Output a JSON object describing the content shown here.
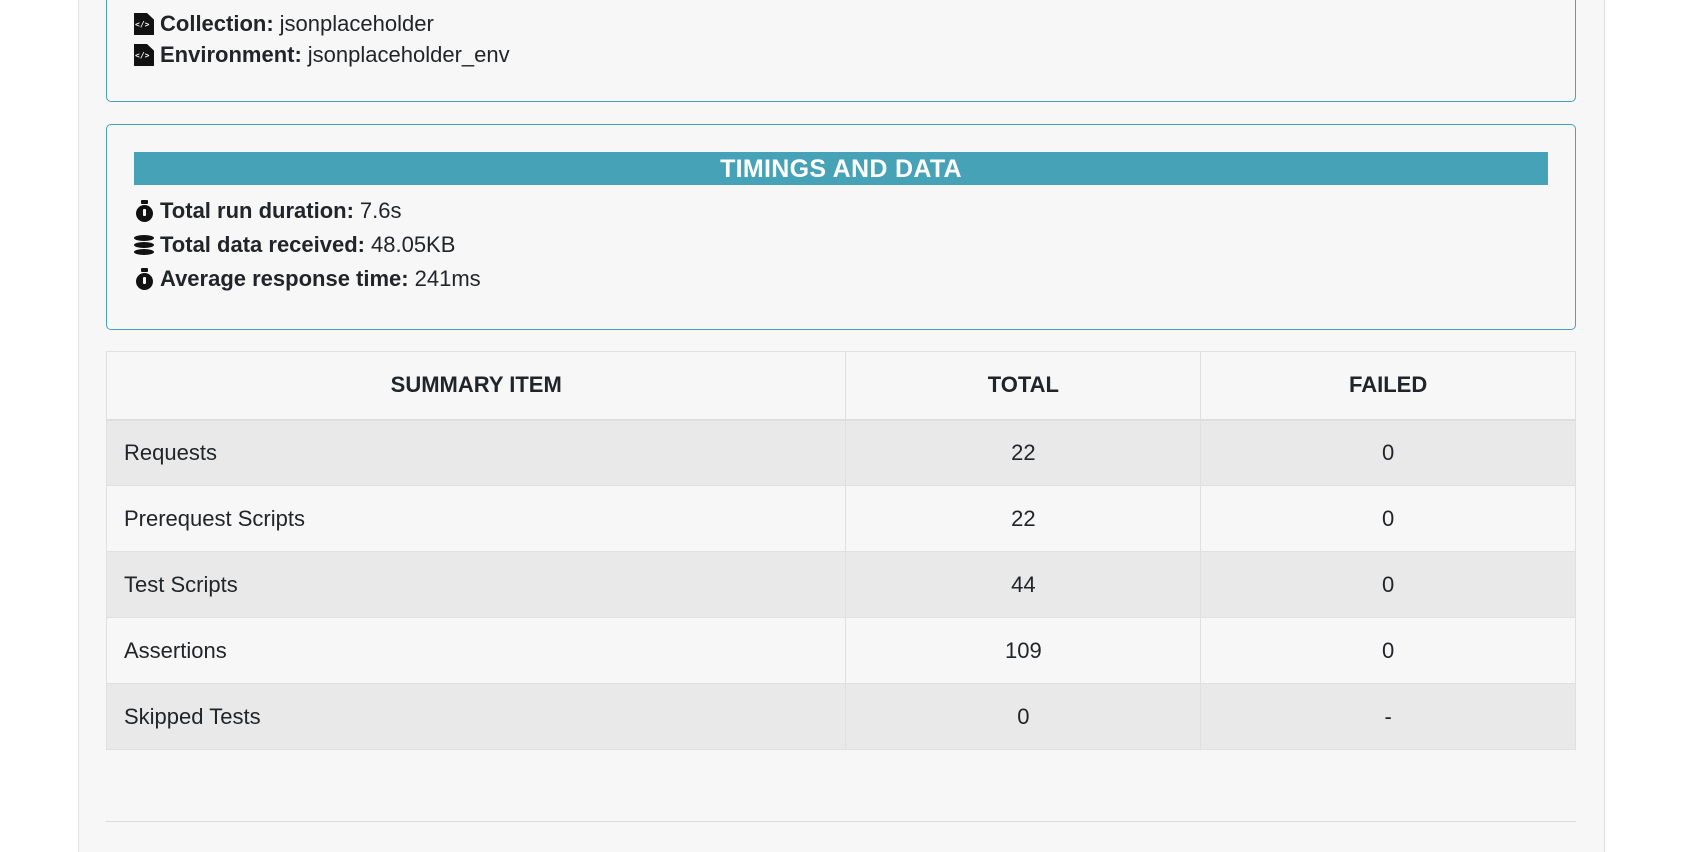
{
  "info": {
    "collection_label": "Collection:",
    "collection_value": "jsonplaceholder",
    "environment_label": "Environment:",
    "environment_value": "jsonplaceholder_env"
  },
  "timings": {
    "title": "TIMINGS AND DATA",
    "run_duration_label": "Total run duration:",
    "run_duration_value": "7.6s",
    "data_received_label": "Total data received:",
    "data_received_value": "48.05KB",
    "avg_response_label": "Average response time:",
    "avg_response_value": "241ms"
  },
  "icons": {
    "collection": "file-code-icon",
    "environment": "file-code-icon",
    "run_duration": "stopwatch-icon",
    "data_received": "database-icon",
    "avg_response": "stopwatch-icon"
  },
  "colors": {
    "accent": "#46a2b7"
  },
  "summary": {
    "headers": [
      "SUMMARY ITEM",
      "TOTAL",
      "FAILED"
    ],
    "rows": [
      {
        "item": "Requests",
        "total": "22",
        "failed": "0"
      },
      {
        "item": "Prerequest Scripts",
        "total": "22",
        "failed": "0"
      },
      {
        "item": "Test Scripts",
        "total": "44",
        "failed": "0"
      },
      {
        "item": "Assertions",
        "total": "109",
        "failed": "0"
      },
      {
        "item": "Skipped Tests",
        "total": "0",
        "failed": "-"
      }
    ]
  }
}
